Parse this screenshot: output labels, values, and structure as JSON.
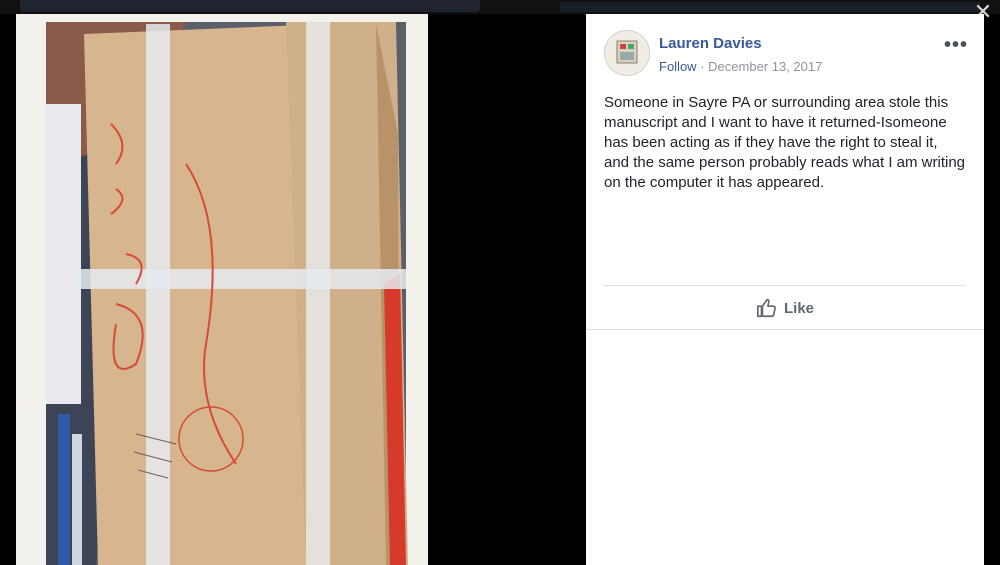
{
  "viewer": {
    "close_glyph": "✕"
  },
  "photo": {
    "subject": "manuscript-bundle-photo",
    "handwriting": [
      "I",
      "am",
      "the",
      "D",
      "Be",
      "Robert",
      "Yeager",
      "Were No",
      "Ticket",
      "Were",
      "But"
    ]
  },
  "post": {
    "author": "Lauren Davies",
    "follow_label": "Follow",
    "separator": "·",
    "date": "December 13, 2017",
    "more_glyph": "•••",
    "text": "Someone in Sayre PA or surrounding area stole this manuscript and I want to have it returned-Isomeone has been acting as if they have the right to steal it, and the same person probably reads what I am writing on the computer it has appeared."
  },
  "actions": {
    "like_label": "Like",
    "like_icon": "thumbs-up-icon"
  },
  "colors": {
    "link": "#385898",
    "meta": "#90949c",
    "text": "#1d2129",
    "divider": "#dadde1",
    "background": "#000000"
  }
}
